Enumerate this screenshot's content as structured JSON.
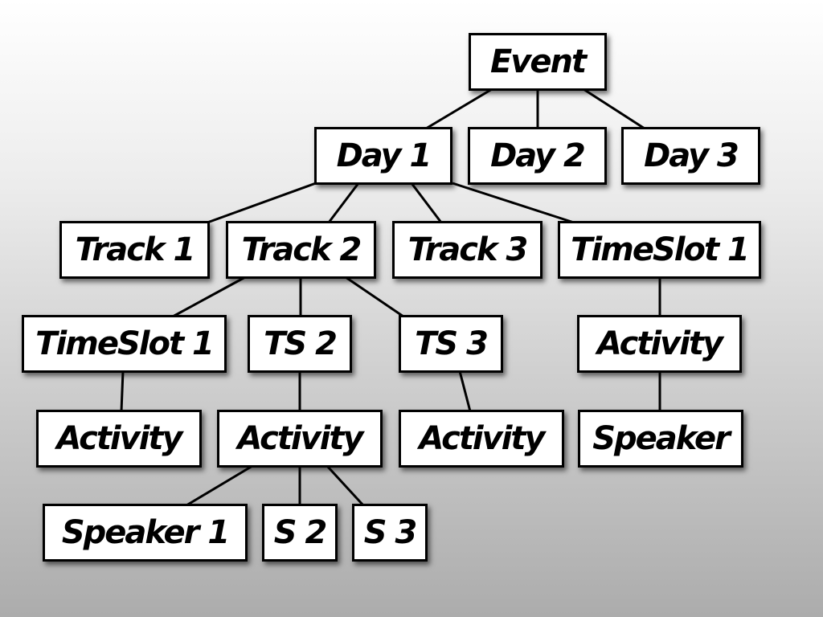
{
  "diagram": {
    "type": "tree",
    "colors": {
      "node_fill": "#ffffff",
      "node_border": "#000000",
      "edge": "#000000",
      "text": "#000000"
    },
    "nodes": [
      {
        "id": "event",
        "label": "Event"
      },
      {
        "id": "day1",
        "label": "Day 1",
        "parent": "event"
      },
      {
        "id": "day2",
        "label": "Day 2",
        "parent": "event"
      },
      {
        "id": "day3",
        "label": "Day 3",
        "parent": "event"
      },
      {
        "id": "track1",
        "label": "Track 1",
        "parent": "day1"
      },
      {
        "id": "track2",
        "label": "Track 2",
        "parent": "day1"
      },
      {
        "id": "track3",
        "label": "Track 3",
        "parent": "day1"
      },
      {
        "id": "timeslot1-day",
        "label": "TimeSlot 1",
        "parent": "day1"
      },
      {
        "id": "timeslot1-track",
        "label": "TimeSlot 1",
        "parent": "track2"
      },
      {
        "id": "ts2",
        "label": "TS 2",
        "parent": "track2"
      },
      {
        "id": "ts3",
        "label": "TS 3",
        "parent": "track2"
      },
      {
        "id": "activity-day",
        "label": "Activity",
        "parent": "timeslot1-day"
      },
      {
        "id": "activity-ts1",
        "label": "Activity",
        "parent": "timeslot1-track"
      },
      {
        "id": "activity-ts2",
        "label": "Activity",
        "parent": "ts2"
      },
      {
        "id": "activity-ts3",
        "label": "Activity",
        "parent": "ts3"
      },
      {
        "id": "speaker-day",
        "label": "Speaker",
        "parent": "activity-day"
      },
      {
        "id": "speaker1",
        "label": "Speaker 1",
        "parent": "activity-ts2"
      },
      {
        "id": "s2",
        "label": "S 2",
        "parent": "activity-ts2"
      },
      {
        "id": "s3",
        "label": "S 3",
        "parent": "activity-ts2"
      }
    ]
  }
}
